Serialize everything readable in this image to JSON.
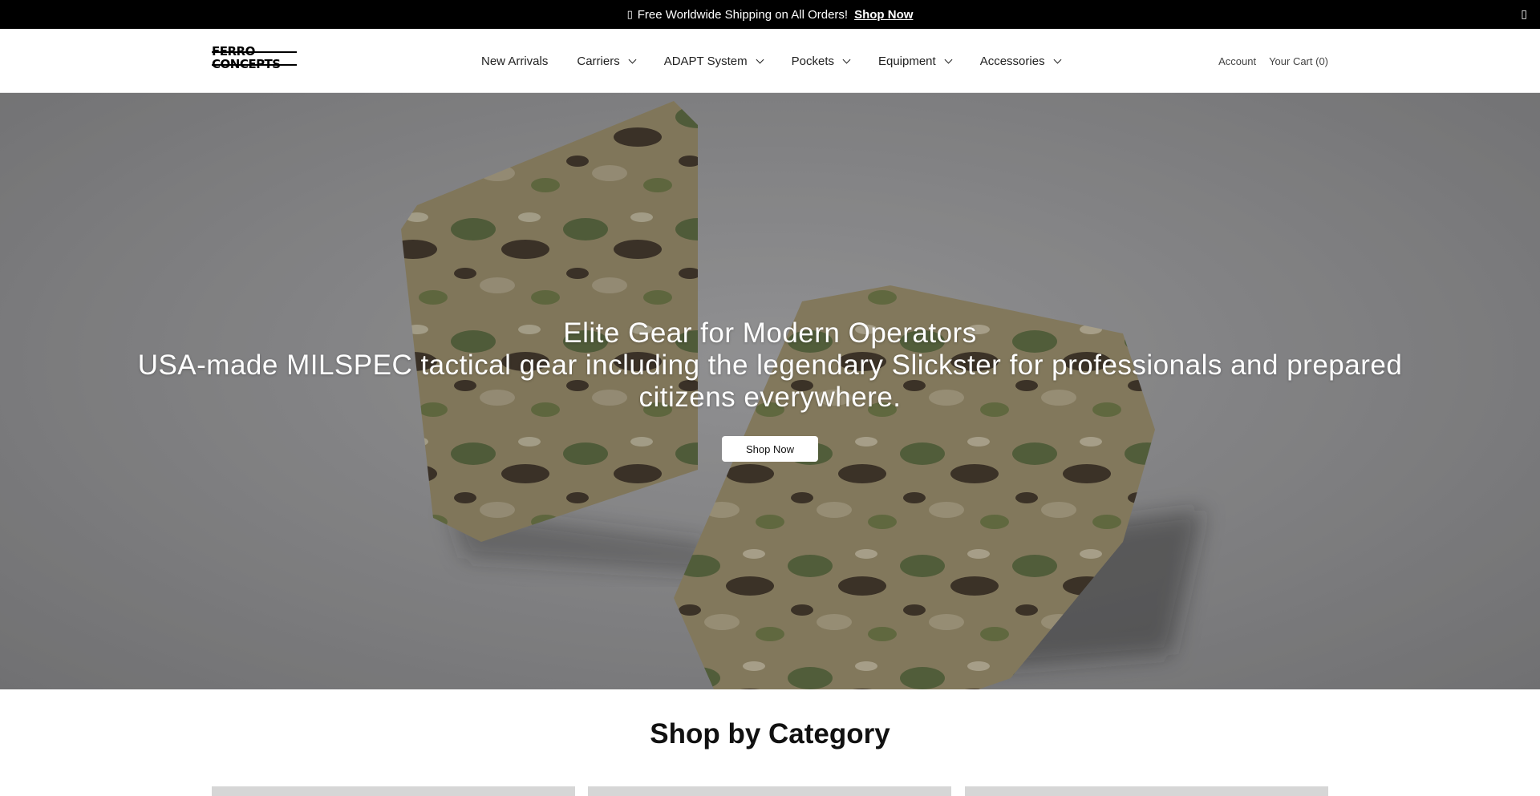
{
  "announcement": {
    "icon": "megaphone-icon",
    "text": "Free Worldwide Shipping on All Orders!",
    "link_label": "Shop Now",
    "close_icon": "close-icon"
  },
  "header": {
    "logo_line1": "FERRO",
    "logo_line2": "CONCEPTS",
    "nav": [
      {
        "label": "New Arrivals",
        "has_dropdown": false
      },
      {
        "label": "Carriers",
        "has_dropdown": true
      },
      {
        "label": "ADAPT System",
        "has_dropdown": true
      },
      {
        "label": "Pockets",
        "has_dropdown": true
      },
      {
        "label": "Equipment",
        "has_dropdown": true
      },
      {
        "label": "Accessories",
        "has_dropdown": true
      }
    ],
    "account_label": "Account",
    "cart_label": "Your Cart (0)"
  },
  "hero": {
    "title": "Elite Gear for Modern Operators",
    "subtitle": "USA-made MILSPEC tactical gear including the legendary Slickster for professionals and prepared citizens everywhere.",
    "button_label": "Shop Now",
    "background_color": "#8b8b8d"
  },
  "categories": {
    "title": "Shop by Category",
    "card_count": 3
  }
}
